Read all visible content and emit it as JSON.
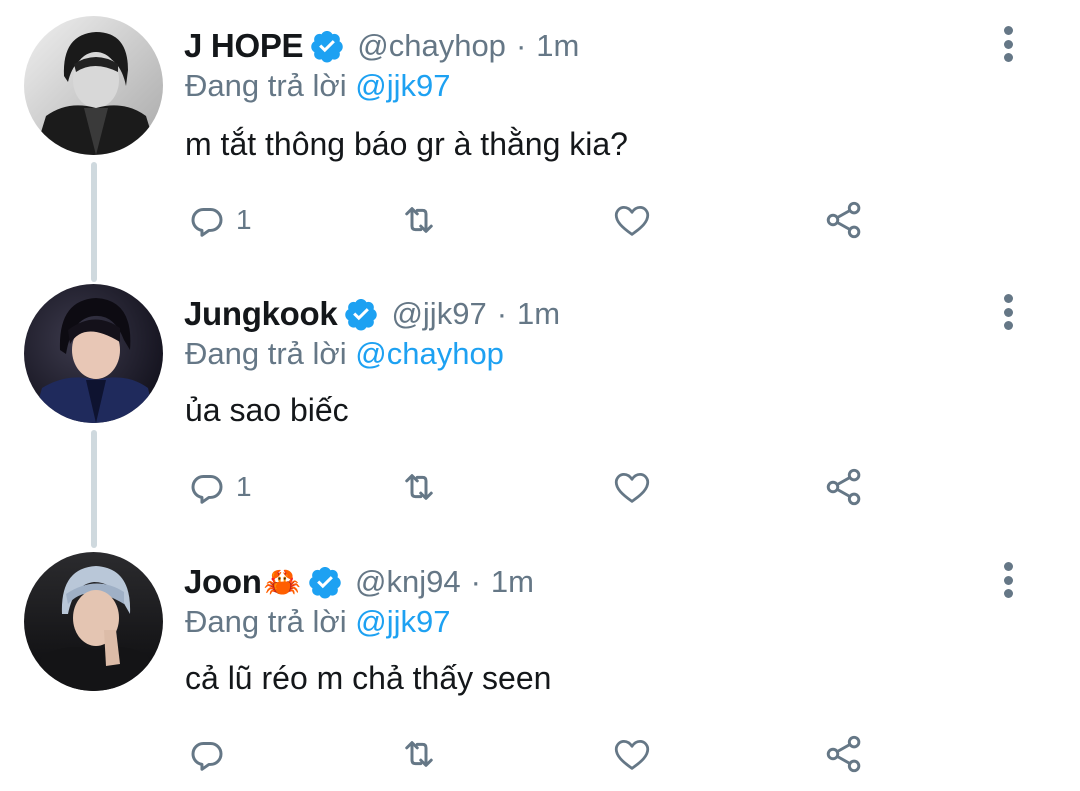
{
  "colors": {
    "accent": "#1da1f2",
    "muted": "#657786",
    "text": "#14171a",
    "verified": "#1da1f2",
    "thread_line": "#cfd9de"
  },
  "tweets": [
    {
      "name": "J HOPE",
      "emoji": "",
      "verified": true,
      "handle": "@chayhop",
      "dot": "·",
      "time": "1m",
      "reply_prefix": "Đang trả lời",
      "reply_mention": "@jjk97",
      "text": "m tắt thông báo gr à thằng kia?",
      "reply_count": "1",
      "icons": [
        "reply-icon",
        "retweet-icon",
        "like-icon",
        "share-icon",
        "more-icon"
      ]
    },
    {
      "name": "Jungkook",
      "emoji": "",
      "verified": true,
      "handle": "@jjk97",
      "dot": "·",
      "time": "1m",
      "reply_prefix": "Đang trả lời",
      "reply_mention": "@chayhop",
      "text": "ủa sao biếc",
      "reply_count": "1",
      "icons": [
        "reply-icon",
        "retweet-icon",
        "like-icon",
        "share-icon",
        "more-icon"
      ]
    },
    {
      "name": "Joon",
      "emoji": "🦀",
      "verified": true,
      "handle": "@knj94",
      "dot": "·",
      "time": "1m",
      "reply_prefix": "Đang trả lời",
      "reply_mention": "@jjk97",
      "text": "cả lũ réo m chả thấy seen",
      "reply_count": "",
      "icons": [
        "reply-icon",
        "retweet-icon",
        "like-icon",
        "share-icon",
        "more-icon"
      ]
    }
  ]
}
